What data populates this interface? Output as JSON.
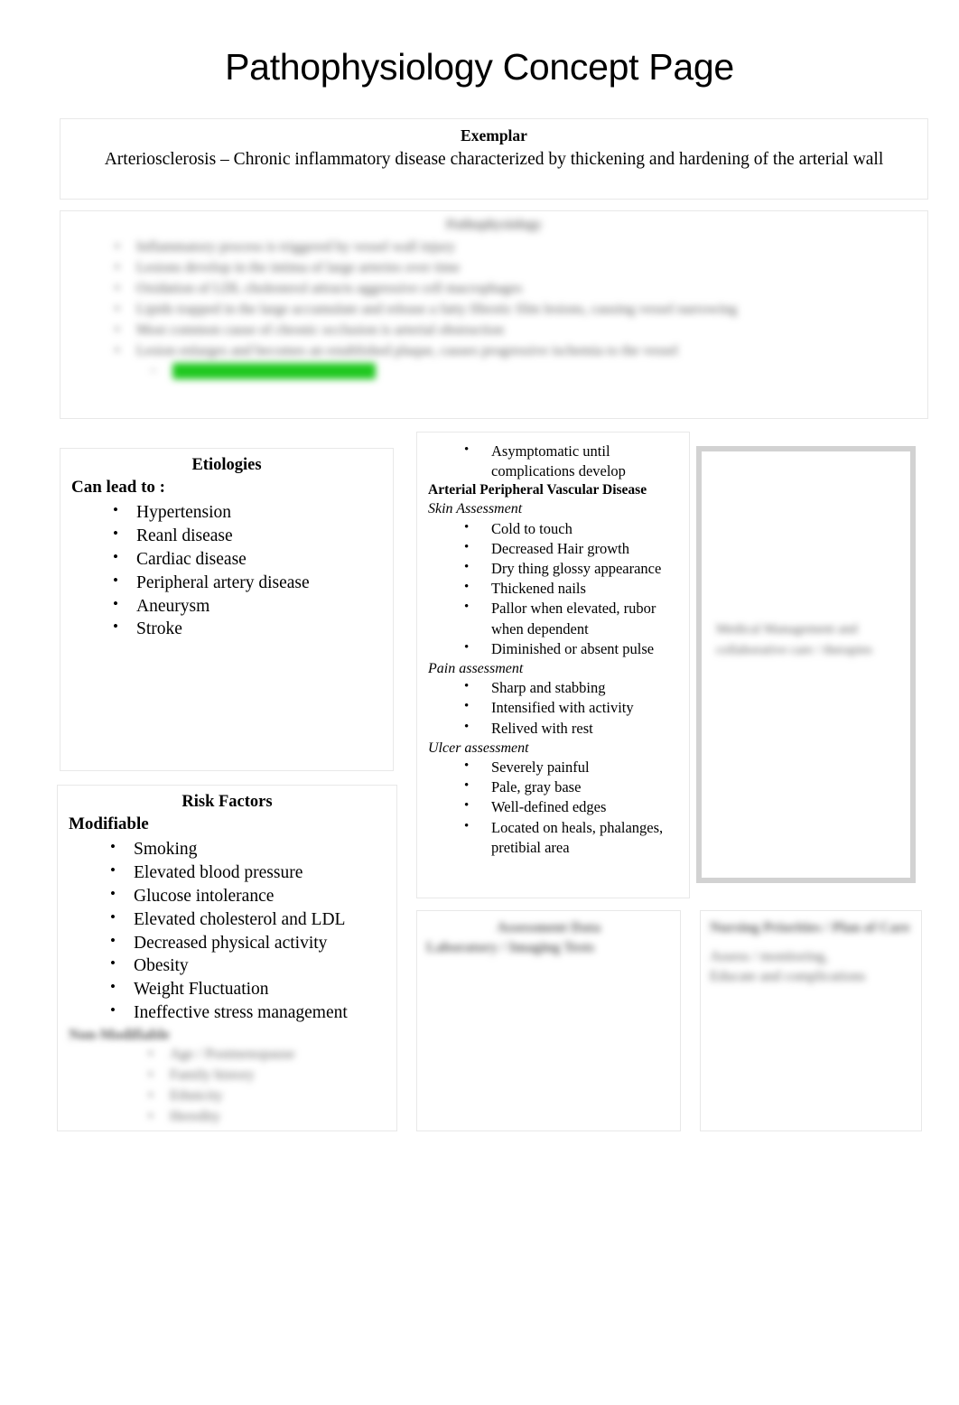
{
  "page": {
    "title": "Pathophysiology Concept Page"
  },
  "exemplar": {
    "heading": "Exemplar",
    "text": "Arteriosclerosis – Chronic inflammatory disease characterized by thickening and hardening of the arterial wall"
  },
  "pathophysiology": {
    "heading": "Pathophysiology",
    "redacted": true,
    "items": [
      "Inflammatory process is triggered by vessel wall injury",
      "Lesions develop in the intima of large arteries over time",
      "Oxidation of LDL cholesterol attracts aggressive cell macrophages",
      "Lipids trapped in the large accumulate and release a fatty fibrotic film lesions, causing vessel narrowing",
      "Most common cause of chronic occlusion is arterial obstruction"
    ],
    "trailing_item": "Lesion enlarges and becomes an established plaque, causes progressive ischemia to the vessel",
    "highlighted_subitem": {
      "text": "",
      "highlight_color": "#1fc81f"
    }
  },
  "etiologies": {
    "title": "Etiologies",
    "lead_in": "Can lead to :",
    "items": [
      "Hypertension",
      "Reanl disease",
      "Cardiac disease",
      "Peripheral artery disease",
      "Aneurysm",
      "Stroke"
    ]
  },
  "risk_factors": {
    "title": "Risk Factors",
    "modifiable_label": "Modifiable",
    "modifiable_items": [
      "Smoking",
      "Elevated blood pressure",
      "Glucose intolerance",
      "Elevated cholesterol and LDL",
      "Decreased physical activity",
      "Obesity",
      "Weight Fluctuation",
      "Ineffective stress management"
    ],
    "nonmodifiable_label": "Non-Modifiable",
    "nonmodifiable_items": [
      "Age / Postmenopause",
      "Family history",
      "Ethnicity",
      "Heredity"
    ],
    "nonmodifiable_redacted": true
  },
  "manifestations": {
    "lead_items": [
      "Asymptomatic until complications develop"
    ],
    "section_heading": "Arterial Peripheral Vascular Disease",
    "subsections": [
      {
        "label": "Skin Assessment",
        "items": [
          "Cold to touch",
          "Decreased Hair growth",
          "Dry thing glossy appearance",
          "Thickened nails",
          "Pallor when elevated, rubor when dependent",
          "Diminished or absent pulse"
        ]
      },
      {
        "label": "Pain assessment",
        "items": [
          "Sharp and stabbing",
          "Intensified with activity",
          "Relived with rest"
        ]
      },
      {
        "label": "Ulcer assessment",
        "items": [
          "Severely painful",
          "Pale, gray base",
          "Well-defined edges",
          "Located on heals, phalanges, pretibial area"
        ]
      }
    ]
  },
  "treatment": {
    "redacted": true,
    "lines": [
      "Medical Management and",
      "collaborative care / therapies"
    ]
  },
  "diagnostics": {
    "redacted": true,
    "heading_lines": [
      "Assessment Data",
      "Laboratory / Imaging Tests"
    ]
  },
  "nursing": {
    "redacted": true,
    "heading": "Nursing Priorities / Plan of Care",
    "lines": [
      "Assess / monitoring,",
      "Educate and complications"
    ]
  }
}
